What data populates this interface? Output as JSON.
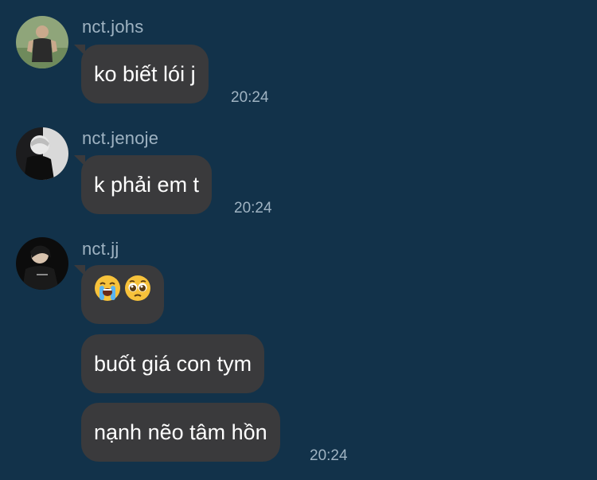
{
  "messages": [
    {
      "username": "nct.johs",
      "bubbles": [
        {
          "text": "ko biết lói j"
        }
      ],
      "time": "20:24"
    },
    {
      "username": "nct.jenoje",
      "bubbles": [
        {
          "text": "k phải em t"
        }
      ],
      "time": "20:24"
    },
    {
      "username": "nct.jj",
      "bubbles": [
        {
          "emojis": [
            "loudly-crying-face-emoji",
            "pleading-face-emoji"
          ]
        },
        {
          "text": "buốt giá con tym"
        },
        {
          "text": "nạnh nẽo tâm hồn"
        }
      ],
      "time": "20:24"
    }
  ],
  "colors": {
    "background": "#12324a",
    "bubble": "#3a3a3c",
    "username": "#9fb3c2",
    "timestamp": "#9fb3c2",
    "message_text": "#ffffff"
  }
}
